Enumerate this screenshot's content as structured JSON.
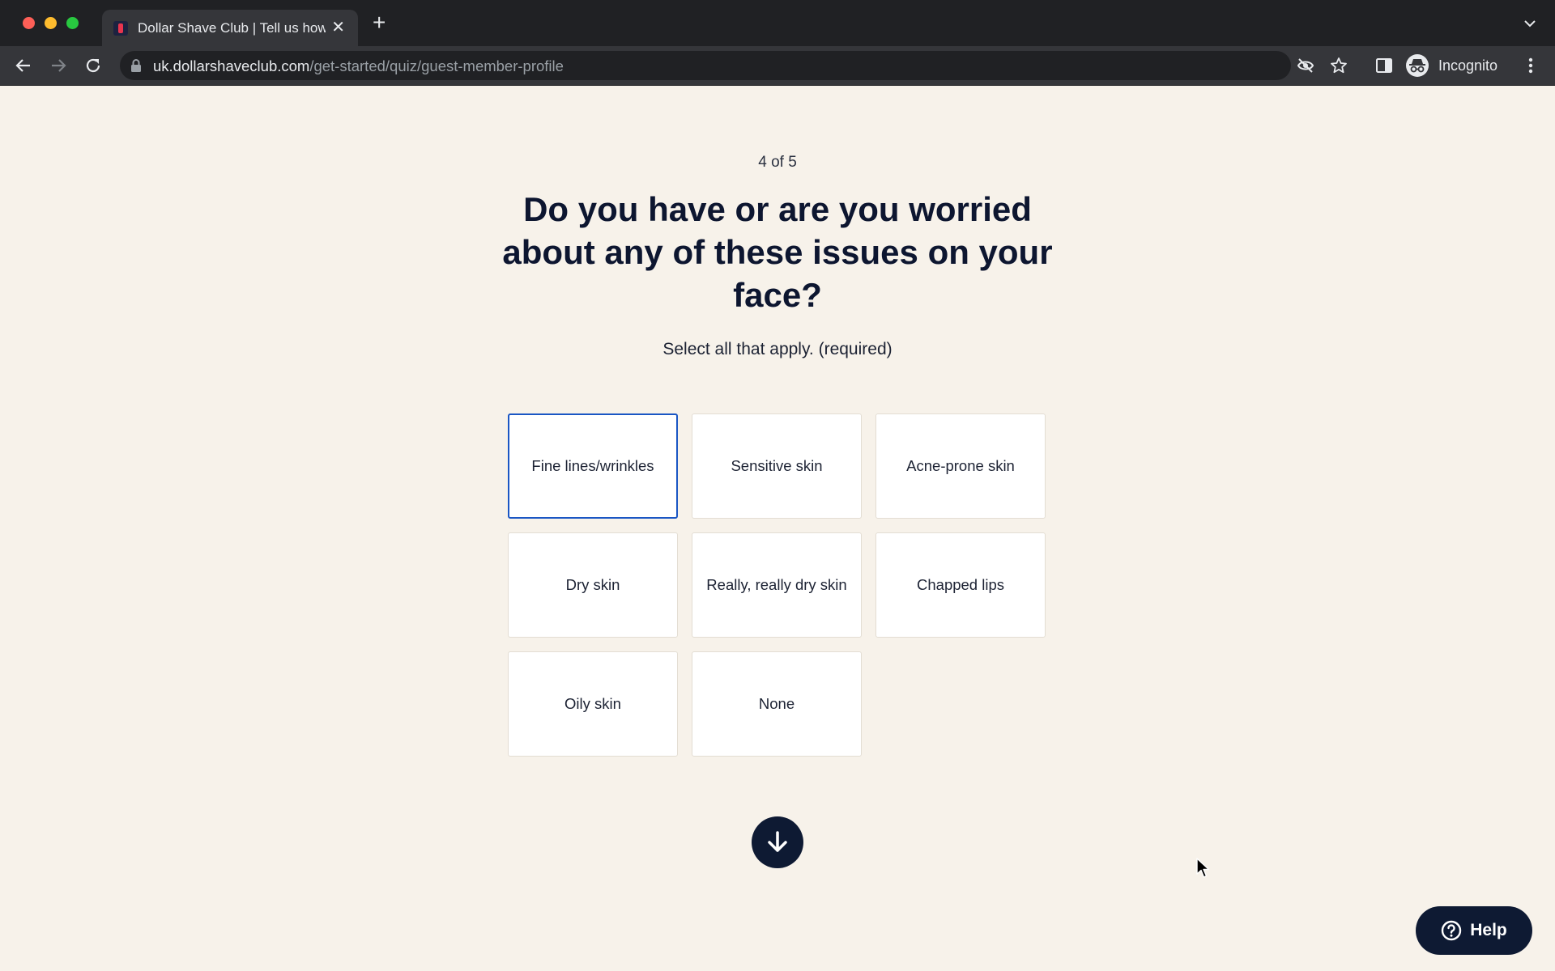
{
  "browser": {
    "tab": {
      "title": "Dollar Shave Club | Tell us how",
      "close_glyph": "✕",
      "favicon": "dsc-favicon"
    },
    "new_tab_glyph": "+",
    "address": {
      "host": "uk.dollarshaveclub.com",
      "path": "/get-started/quiz/guest-member-profile"
    },
    "profile_label": "Incognito",
    "icons": [
      "back-icon",
      "forward-icon",
      "reload-icon",
      "lock-icon",
      "eye-off-icon",
      "star-icon",
      "side-panel-icon",
      "incognito-icon",
      "more-vert-icon",
      "tab-list-icon"
    ]
  },
  "quiz": {
    "step": "4 of 5",
    "question": "Do you have or are you worried about any of these issues on your face?",
    "hint": "Select all that apply. (required)",
    "options": [
      {
        "label": "Fine lines/wrinkles",
        "selected": true
      },
      {
        "label": "Sensitive skin",
        "selected": false
      },
      {
        "label": "Acne-prone skin",
        "selected": false
      },
      {
        "label": "Dry skin",
        "selected": false
      },
      {
        "label": "Really, really dry skin",
        "selected": false
      },
      {
        "label": "Chapped lips",
        "selected": false
      },
      {
        "label": "Oily skin",
        "selected": false
      },
      {
        "label": "None",
        "selected": false
      }
    ],
    "next_icon": "arrow-down-icon"
  },
  "help": {
    "label": "Help",
    "icon": "question-circle-icon"
  },
  "colors": {
    "page_background": "#f7f2ea",
    "navy": "#0e1a33",
    "selected_border": "#1a56c4",
    "chrome_dark": "#202124",
    "chrome_toolbar": "#35363a"
  }
}
